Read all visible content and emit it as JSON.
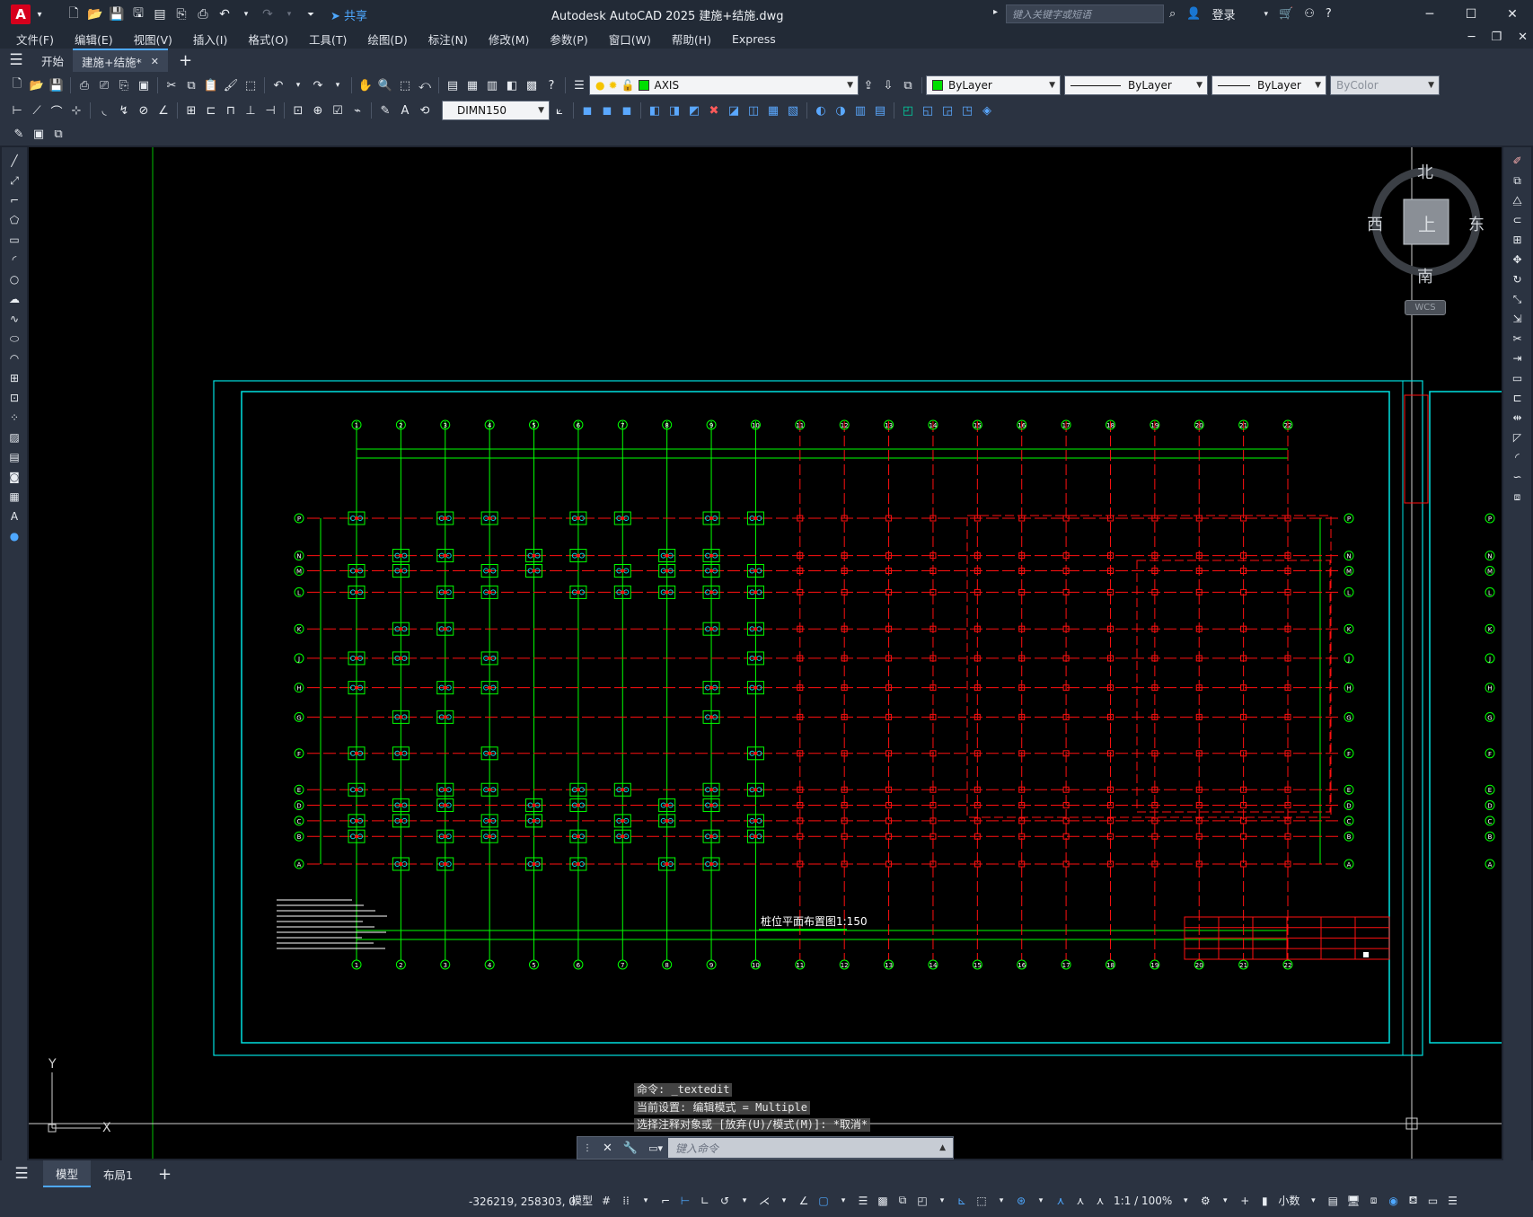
{
  "app": {
    "title": "Autodesk AutoCAD 2025    建施+结施.dwg",
    "logo": "A",
    "share_label": "共享",
    "search_placeholder": "键入关键字或短语",
    "login_label": "登录"
  },
  "menu": {
    "items": [
      "文件(F)",
      "编辑(E)",
      "视图(V)",
      "插入(I)",
      "格式(O)",
      "工具(T)",
      "绘图(D)",
      "标注(N)",
      "修改(M)",
      "参数(P)",
      "窗口(W)",
      "帮助(H)",
      "Express"
    ]
  },
  "tabs": {
    "start_label": "开始",
    "doc_label": "建施+结施*"
  },
  "properties": {
    "layer_name": "AXIS",
    "layer_color": "#00e000",
    "color_label": "ByLayer",
    "color_swatch": "#00e000",
    "linetype_label": "ByLayer",
    "lineweight_label": "ByLayer",
    "plotstyle_label": "ByColor",
    "dimstyle_label": "DIMN150"
  },
  "viewcube": {
    "north": "北",
    "south": "南",
    "east": "东",
    "west": "西",
    "top": "上",
    "wcs_label": "WCS"
  },
  "drawing": {
    "plan_title": "桩位平面布置图1:150",
    "axis_x_labels": [
      "1",
      "2",
      "3",
      "4",
      "5",
      "6",
      "7",
      "8",
      "9",
      "10",
      "11",
      "12",
      "13",
      "14",
      "15",
      "16",
      "17",
      "18",
      "19",
      "20",
      "21",
      "22"
    ],
    "axis_y_labels": [
      "P",
      "N",
      "M",
      "L",
      "K",
      "J",
      "H",
      "G",
      "F",
      "E",
      "D",
      "C",
      "B",
      "A"
    ],
    "ucs_y": "Y",
    "ucs_x": "X",
    "colors": {
      "frame": "#00e0e0",
      "axis": "#00ff00",
      "structure": "#ff1010",
      "bg": "#000000"
    }
  },
  "command": {
    "history": [
      "命令: _textedit",
      "当前设置: 编辑模式 = Multiple",
      "选择注释对象或 [放弃(U)/模式(M)]: *取消*"
    ],
    "placeholder": "键入命令"
  },
  "layouts": {
    "items": [
      "模型",
      "布局1"
    ]
  },
  "status": {
    "coords": "-326219, 258303, 0",
    "mode_label": "模型",
    "scale_label": "1:1 / 100%",
    "units_label": "小数"
  }
}
